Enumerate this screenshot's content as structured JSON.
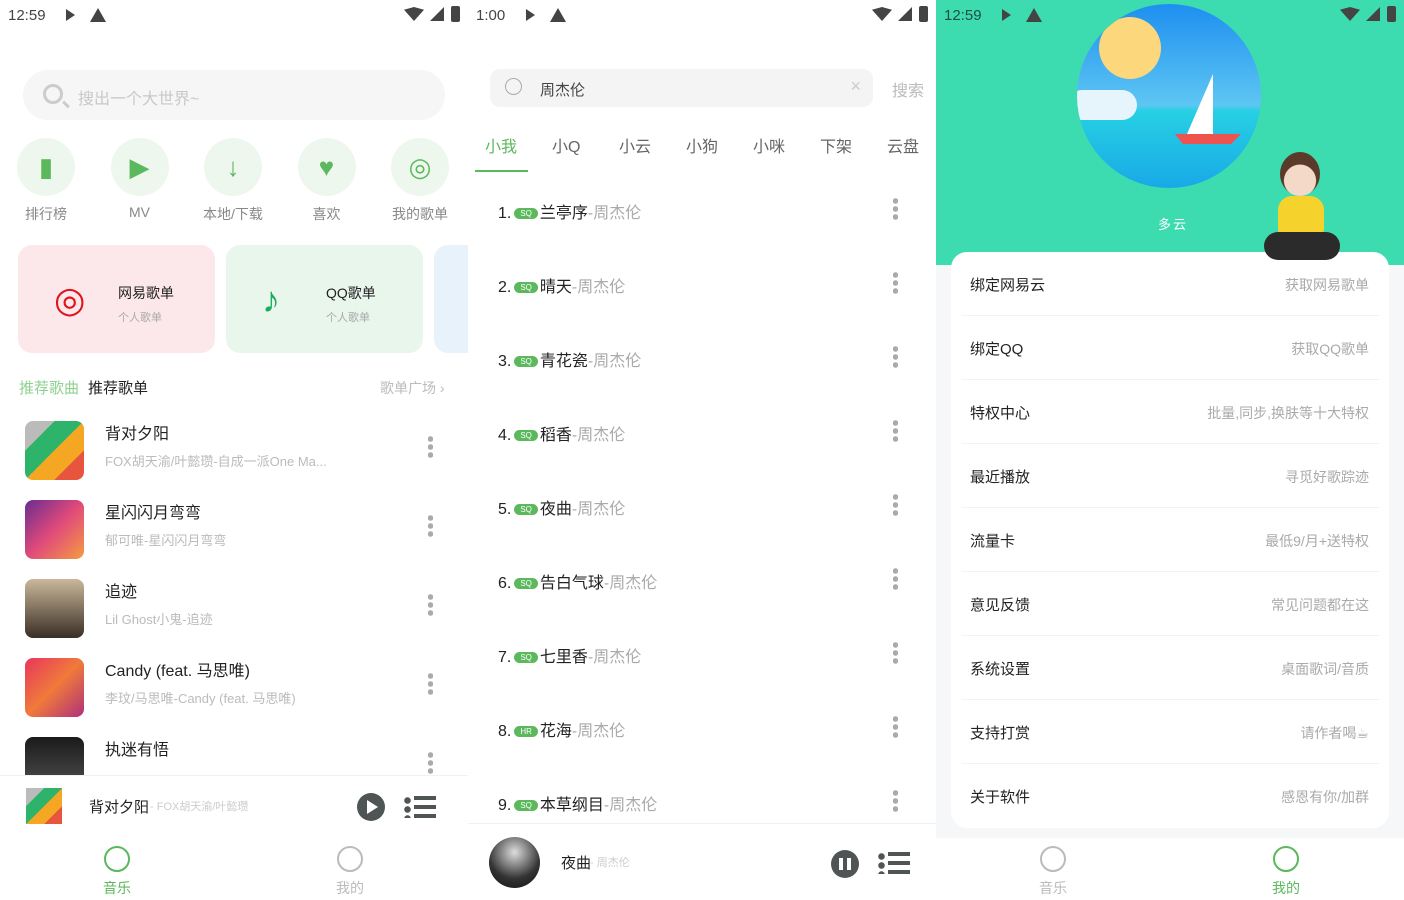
{
  "colors": {
    "accent": "#5cb85c",
    "hero": "#3ddbb0"
  },
  "home": {
    "status_time": "12:59",
    "search_placeholder": "搜出一个大世界~",
    "quick": [
      {
        "label": "排行榜",
        "icon": "bar-chart-icon"
      },
      {
        "label": "MV",
        "icon": "video-icon"
      },
      {
        "label": "本地/下载",
        "icon": "download-folder-icon"
      },
      {
        "label": "喜欢",
        "icon": "heart-icon"
      },
      {
        "label": "我的歌单",
        "icon": "disc-icon"
      }
    ],
    "cards": [
      {
        "title": "网易歌单",
        "sub": "个人歌单",
        "icon": "netease-icon"
      },
      {
        "title": "QQ歌单",
        "sub": "个人歌单",
        "icon": "qq-music-icon"
      }
    ],
    "section": {
      "tab_active": "推荐歌曲",
      "tab_other": "推荐歌单",
      "more": "歌单广场 ›"
    },
    "songs": [
      {
        "title": "背对夕阳",
        "sub": "FOX胡天渝/叶懿瓒-自成一派One Ma..."
      },
      {
        "title": "星闪闪月弯弯",
        "sub": "郁可唯-星闪闪月弯弯"
      },
      {
        "title": "追迹",
        "sub": "Lil Ghost小鬼-追迹"
      },
      {
        "title": "Candy (feat. 马思唯)",
        "sub": "李玟/马思唯-Candy (feat. 马思唯)"
      },
      {
        "title": "执迷有悟",
        "sub": ""
      }
    ],
    "player": {
      "title": "背对夕阳",
      "artist": " - FOX胡天渝/叶懿瓒",
      "state": "paused"
    },
    "nav": [
      {
        "label": "音乐",
        "active": true
      },
      {
        "label": "我的",
        "active": false
      }
    ]
  },
  "search": {
    "status_time": "1:00",
    "query": "周杰伦",
    "button": "搜索",
    "tabs": [
      "小我",
      "小Q",
      "小云",
      "小狗",
      "小咪",
      "下架",
      "云盘"
    ],
    "active_tab": "小我",
    "results": [
      {
        "n": "1.",
        "q": "SQ",
        "t": "兰亭序",
        "a": "-周杰伦"
      },
      {
        "n": "2.",
        "q": "SQ",
        "t": "晴天",
        "a": "-周杰伦"
      },
      {
        "n": "3.",
        "q": "SQ",
        "t": "青花瓷",
        "a": "-周杰伦"
      },
      {
        "n": "4.",
        "q": "SQ",
        "t": "稻香",
        "a": "-周杰伦"
      },
      {
        "n": "5.",
        "q": "SQ",
        "t": "夜曲",
        "a": "-周杰伦"
      },
      {
        "n": "6.",
        "q": "SQ",
        "t": "告白气球",
        "a": "-周杰伦"
      },
      {
        "n": "7.",
        "q": "SQ",
        "t": "七里香",
        "a": "-周杰伦"
      },
      {
        "n": "8.",
        "q": "HR",
        "t": "花海",
        "a": "-周杰伦"
      },
      {
        "n": "9.",
        "q": "SQ",
        "t": "本草纲目",
        "a": "-周杰伦"
      }
    ],
    "player": {
      "title": "夜曲",
      "artist": "- 周杰伦",
      "state": "playing"
    }
  },
  "mine": {
    "status_time": "12:59",
    "weather": "多云",
    "settings": [
      {
        "k": "绑定网易云",
        "v": "获取网易歌单"
      },
      {
        "k": "绑定QQ",
        "v": "获取QQ歌单"
      },
      {
        "k": "特权中心",
        "v": "批量,同步,换肤等十大特权"
      },
      {
        "k": "最近播放",
        "v": "寻觅好歌踪迹"
      },
      {
        "k": "流量卡",
        "v": "最低9/月+送特权"
      },
      {
        "k": "意见反馈",
        "v": "常见问题都在这"
      },
      {
        "k": "系统设置",
        "v": "桌面歌词/音质"
      },
      {
        "k": "支持打赏",
        "v": "请作者喝☕"
      },
      {
        "k": "关于软件",
        "v": "感恩有你/加群"
      }
    ],
    "nav": [
      {
        "label": "音乐",
        "active": false
      },
      {
        "label": "我的",
        "active": true
      }
    ]
  }
}
